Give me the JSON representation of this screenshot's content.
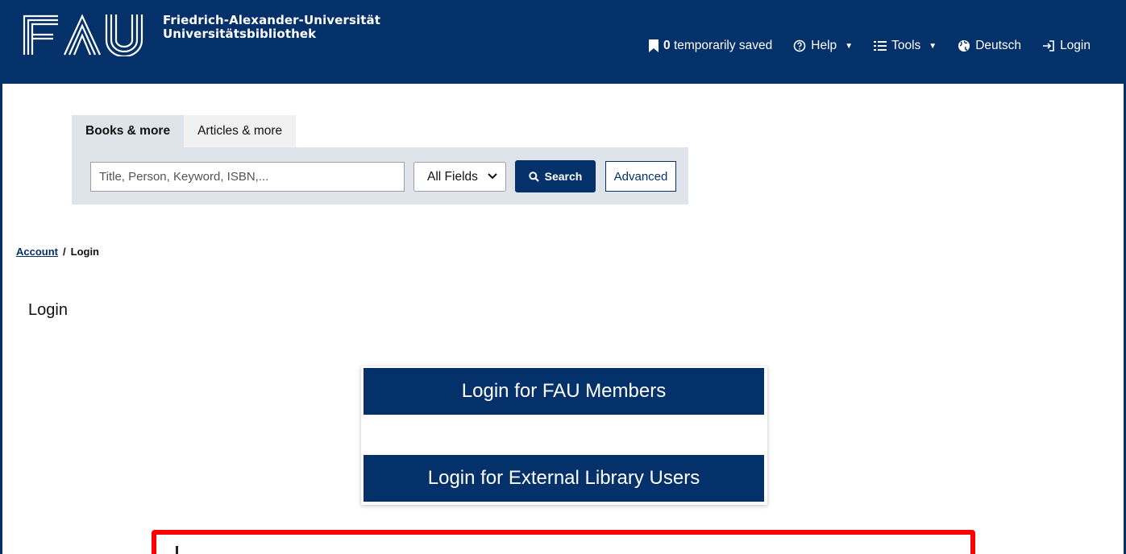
{
  "header": {
    "brand_line1": "Friedrich-Alexander-Universität",
    "brand_line2": "Universitätsbibliothek",
    "logo_icon": "fau-logo-icon",
    "nav": {
      "saved_count": "0",
      "saved_label": "temporarily saved",
      "help_label": "Help",
      "tools_label": "Tools",
      "language_label": "Deutsch",
      "login_label": "Login"
    }
  },
  "search": {
    "tabs": [
      {
        "label": "Books & more",
        "active": true
      },
      {
        "label": "Articles & more",
        "active": false
      }
    ],
    "placeholder": "Title, Person, Keyword, ISBN,...",
    "value": "",
    "field_select": "All Fields",
    "search_button": "Search",
    "advanced_button": "Advanced"
  },
  "breadcrumb": {
    "parent": "Account",
    "separator": "/",
    "current": "Login"
  },
  "page": {
    "title": "Login",
    "login_fau": "Login for FAU Members",
    "login_external": "Login for External Library Users"
  },
  "colors": {
    "primary": "#04316a",
    "panel": "#dfe3ea",
    "notice_border": "#ff0000"
  }
}
